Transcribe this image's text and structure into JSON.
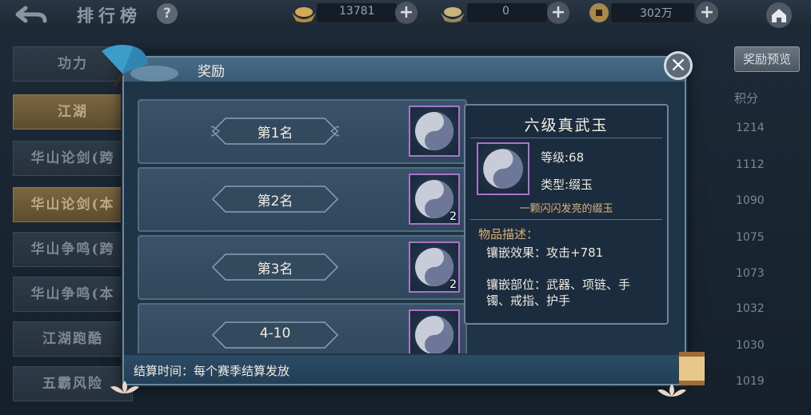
{
  "topbar": {
    "title": "排行榜",
    "help": "?",
    "resources": [
      {
        "icon": "gold-ingot-icon",
        "value": "13781"
      },
      {
        "icon": "silver-ingot-icon",
        "value": "0"
      },
      {
        "icon": "copper-coin-icon",
        "value": "302万"
      }
    ],
    "plus": "+"
  },
  "sidebar": {
    "items": [
      {
        "label": "功力",
        "active": false
      },
      {
        "label": "江湖",
        "active": true
      },
      {
        "label": "华山论剑(跨",
        "active": false
      },
      {
        "label": "华山论剑(本",
        "active": true
      },
      {
        "label": "华山争鸣(跨",
        "active": false
      },
      {
        "label": "华山争鸣(本",
        "active": false
      },
      {
        "label": "江湖跑酷",
        "active": false
      },
      {
        "label": "五霸风险",
        "active": false
      }
    ]
  },
  "right_panel": {
    "preview_label": "奖励预览",
    "score_header": "积分",
    "scores": [
      "1214",
      "1112",
      "1090",
      "1075",
      "1073",
      "1032",
      "1030",
      "1019"
    ]
  },
  "modal": {
    "title": "奖励",
    "close": "×",
    "ranks": [
      {
        "label": "第1名",
        "count": ""
      },
      {
        "label": "第2名",
        "count": "2"
      },
      {
        "label": "第3名",
        "count": "2"
      },
      {
        "label": "4-10",
        "count": ""
      }
    ],
    "footer": "结算时间：每个赛季结算发放"
  },
  "tooltip": {
    "name": "六级真武玉",
    "level": "等级:68",
    "type": "类型:缀玉",
    "flavor": "一颗闪闪发亮的缀玉",
    "desc_title": "物品描述：",
    "effect": "镶嵌效果：攻击+781",
    "slots_line1": "镶嵌部位：武器、项链、手",
    "slots_line2": "镯、戒指、护手"
  },
  "colors": {
    "accent_gold": "#d9b37a",
    "item_border_purple": "#a873c9",
    "active_tab": "#7b6641"
  }
}
